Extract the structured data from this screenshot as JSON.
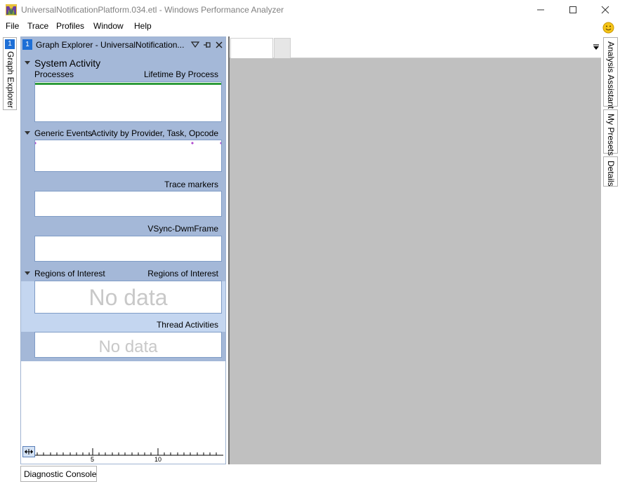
{
  "window": {
    "title": "UniversalNotificationPlatform.034.etl - Windows Performance Analyzer"
  },
  "menu": [
    "File",
    "Trace",
    "Profiles",
    "Window",
    "Help"
  ],
  "left_tab": {
    "number": "1",
    "label": "Graph Explorer"
  },
  "graph_explorer": {
    "number": "1",
    "title": "Graph Explorer - UniversalNotification...",
    "sections": [
      {
        "title": "System Activity",
        "left_label": "Processes",
        "right_label": "Lifetime By Process"
      },
      {
        "title": "Generic Events",
        "right_label": "Activity by Provider, Task, Opcode"
      },
      {
        "right_label": "Trace markers"
      },
      {
        "right_label": "VSync-DwmFrame"
      },
      {
        "title": "Regions of Interest",
        "right_label": "Regions of Interest",
        "placeholder": "No data"
      },
      {
        "right_label": "Thread Activities",
        "placeholder": "No data"
      }
    ],
    "ruler": {
      "ticks": [
        "5",
        "10"
      ]
    }
  },
  "right_tabs": [
    "Analysis Assistant",
    "My Presets",
    "Details"
  ],
  "bottom": {
    "diagnostic_console": "Diagnostic Console"
  },
  "colors": {
    "panel_bg": "#a4b8d8",
    "roi_highlight": "#c4d6f0",
    "workspace": "#c0c0c0",
    "accent": "#1e6fd6",
    "process_bar": "#2e9b3a",
    "event_marker": "#b04ad0"
  }
}
